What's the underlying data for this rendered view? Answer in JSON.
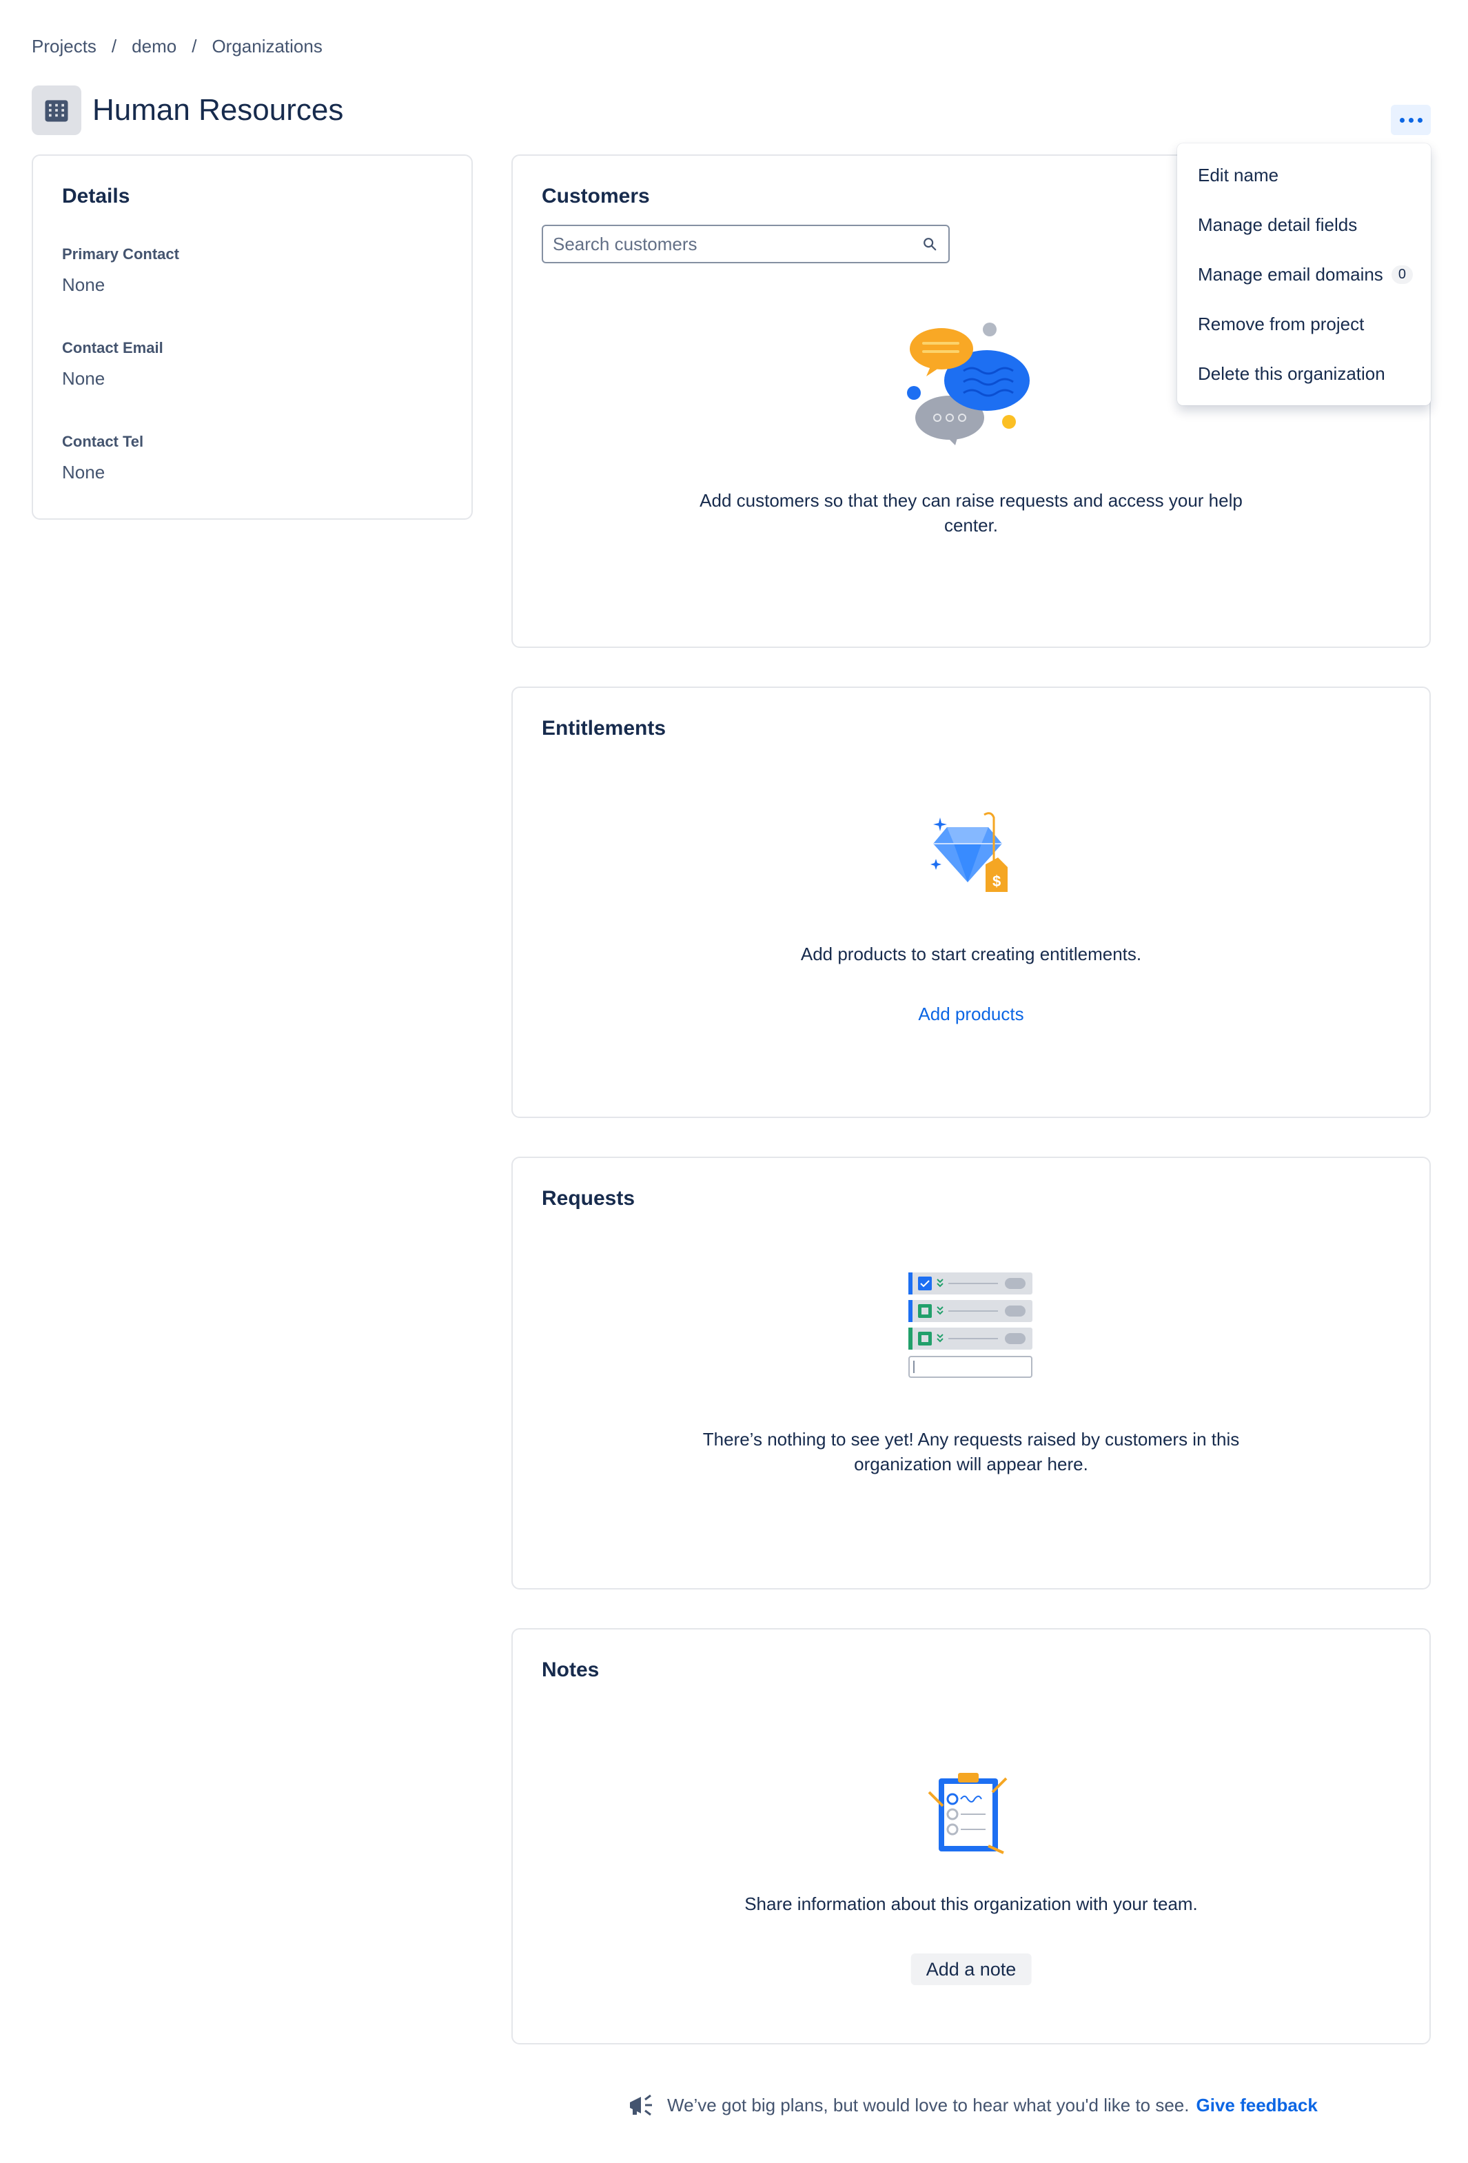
{
  "breadcrumb": {
    "items": [
      "Projects",
      "demo",
      "Organizations"
    ],
    "separator": "/"
  },
  "header": {
    "title": "Human Resources",
    "icon": "building-icon",
    "more_icon": "more-horizontal-icon"
  },
  "dropdown": {
    "items": [
      {
        "label": "Edit name"
      },
      {
        "label": "Manage detail fields"
      },
      {
        "label": "Manage email domains",
        "badge": "0"
      },
      {
        "label": "Remove from project"
      },
      {
        "label": "Delete this organization"
      }
    ]
  },
  "details": {
    "title": "Details",
    "fields": [
      {
        "label": "Primary Contact",
        "value": "None"
      },
      {
        "label": "Contact Email",
        "value": "None"
      },
      {
        "label": "Contact Tel",
        "value": "None"
      }
    ]
  },
  "customers": {
    "title": "Customers",
    "search_placeholder": "Search customers",
    "empty_text": "Add customers so that they can raise requests and access your help center."
  },
  "entitlements": {
    "title": "Entitlements",
    "empty_text": "Add products to start creating entitlements.",
    "action": "Add products"
  },
  "requests": {
    "title": "Requests",
    "empty_text": "There’s nothing to see yet! Any requests raised by customers in this organization will appear here."
  },
  "notes": {
    "title": "Notes",
    "empty_text": "Share information about this organization with your team.",
    "action": "Add a note"
  },
  "footer": {
    "text": "We’ve got big plans, but would love to hear what you'd like to see.",
    "link": "Give feedback"
  },
  "colors": {
    "link": "#0c66e4",
    "text": "#172b4d",
    "subtle": "#44546f",
    "border": "#e4e6ea"
  }
}
